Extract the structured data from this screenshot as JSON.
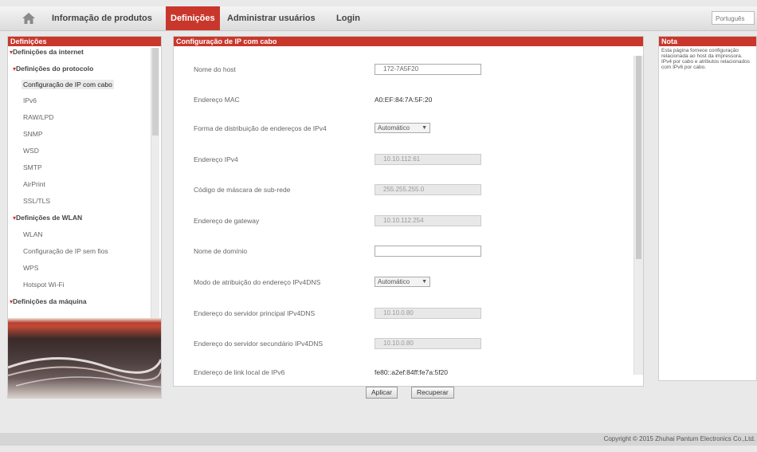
{
  "top_nav": {
    "items": [
      {
        "label": "Informação de produtos",
        "active": false
      },
      {
        "label": "Definições",
        "active": true
      },
      {
        "label": "Administrar usuários",
        "active": false
      },
      {
        "label": "Login",
        "active": false
      }
    ],
    "language": "Português"
  },
  "sidebar": {
    "title": "Definições",
    "items": [
      {
        "label": "Definições da internet",
        "type": "section"
      },
      {
        "label": "Definições do protocolo",
        "type": "subsection"
      },
      {
        "label": "Configuração de IP com cabo",
        "type": "item",
        "active": true
      },
      {
        "label": "IPv6",
        "type": "item"
      },
      {
        "label": "RAW/LPD",
        "type": "item"
      },
      {
        "label": "SNMP",
        "type": "item"
      },
      {
        "label": "WSD",
        "type": "item"
      },
      {
        "label": "SMTP",
        "type": "item"
      },
      {
        "label": "AirPrint",
        "type": "item"
      },
      {
        "label": "SSL/TLS",
        "type": "item"
      },
      {
        "label": "Definições de WLAN",
        "type": "subsection"
      },
      {
        "label": "WLAN",
        "type": "item"
      },
      {
        "label": "Configuração de IP sem fios",
        "type": "item"
      },
      {
        "label": "WPS",
        "type": "item"
      },
      {
        "label": "Hotspot Wi-Fi",
        "type": "item"
      },
      {
        "label": "Definições da máquina",
        "type": "section"
      }
    ]
  },
  "main": {
    "title": "Configuração de IP com cabo",
    "fields": {
      "host_name": {
        "label": "Nome do host",
        "value": "172-7A5F20"
      },
      "mac": {
        "label": "Endereço MAC",
        "value": "A0:EF:84:7A:5F:20"
      },
      "ipv4_dist": {
        "label": "Forma de distribuição de endereços de IPv4",
        "value": "Automático"
      },
      "ipv4": {
        "label": "Endereço IPv4",
        "value": "10.10.112.61"
      },
      "subnet": {
        "label": "Código de máscara de sub-rede",
        "value": "255.255.255.0"
      },
      "gateway": {
        "label": "Endereço de gateway",
        "value": "10.10.112.254"
      },
      "domain": {
        "label": "Nome de domínio",
        "value": ""
      },
      "dns_mode": {
        "label": "Modo de atribuição do endereço IPv4DNS",
        "value": "Automático"
      },
      "dns_primary": {
        "label": "Endereço do servidor principal IPv4DNS",
        "value": "10.10.0.80"
      },
      "dns_secondary": {
        "label": "Endereço do servidor secundário IPv4DNS",
        "value": "10.10.0.80"
      },
      "ipv6_local": {
        "label": "Endereço de link local de IPv6",
        "value": "fe80::a2ef:84ff:fe7a:5f20"
      }
    },
    "apply_label": "Aplicar",
    "reset_label": "Recuperar"
  },
  "note": {
    "title": "Nota",
    "text": "Esta página fornece configuração relacionada ao host da impressora. IPv4 por cabo e atributos relacionados com IPv6 por cabo."
  },
  "footer": {
    "copyright": "Copyright © 2015 Zhuhai Pantum Electronics Co.,Ltd."
  },
  "colors": {
    "accent": "#c9372c",
    "background": "#e9e9e9"
  }
}
